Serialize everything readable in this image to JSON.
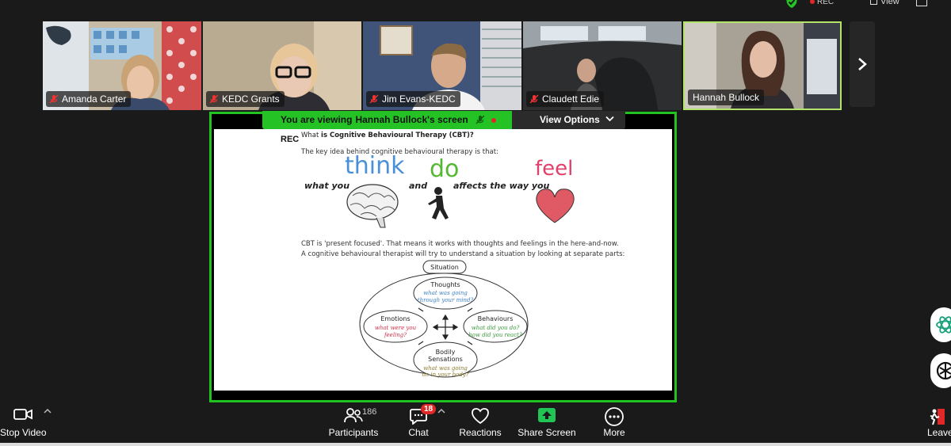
{
  "topbar": {
    "rec": "REC",
    "view": "View"
  },
  "participants": [
    {
      "name": "Amanda Carter",
      "bg": "#c7b59a"
    },
    {
      "name": "KEDC Grants",
      "bg": "#9e8f7a"
    },
    {
      "name": "Jim Evans-KEDC",
      "bg": "#5a6b86"
    },
    {
      "name": "Claudett Edie",
      "bg": "#3a3b3c"
    },
    {
      "name": "Hannah Bullock",
      "bg": "#8e8478"
    }
  ],
  "share": {
    "banner_prefix": "You are viewing",
    "banner_name": "Hannah Bullock's screen",
    "rec": "REC",
    "view_options": "View Options"
  },
  "doc": {
    "heading_plain": "What ",
    "heading_bold": "is Cognitive Behavioural Therapy (CBT)?",
    "intro": "The key idea behind cognitive behavioural therapy is that:",
    "what_you": "what you",
    "think": "think",
    "and": "and",
    "do": "do",
    "affects": "affects the way you",
    "feel": "feel",
    "line1": "CBT is 'present focused'. That means it works with thoughts and feelings in the here-and-now.",
    "line2": "A cognitive behavioural therapist will try to understand a situation by looking at separate parts:",
    "situation": "Situation",
    "thoughts": "Thoughts",
    "thoughts_q1": "what was going",
    "thoughts_q2": "through your mind?",
    "emotions": "Emotions",
    "emotions_q1": "what were you",
    "emotions_q2": "feeling?",
    "behaviours": "Behaviours",
    "behaviours_q1": "what did you do?",
    "behaviours_q2": "how did you react?",
    "bodily1": "Bodily",
    "bodily2": "Sensations",
    "bodily_q1": "what was going",
    "bodily_q2": "on in your body?"
  },
  "toolbar": {
    "stop_video": "Stop Video",
    "participants": "Participants",
    "participants_count": "186",
    "chat": "Chat",
    "chat_badge": "18",
    "reactions": "Reactions",
    "share_screen": "Share Screen",
    "more": "More",
    "leave": "Leave"
  },
  "colors": {
    "share_green": "#21c221",
    "active_border": "#b4e36a",
    "think_blue": "#4a90d9",
    "do_green": "#55b832",
    "feel_pink": "#e0406a"
  }
}
